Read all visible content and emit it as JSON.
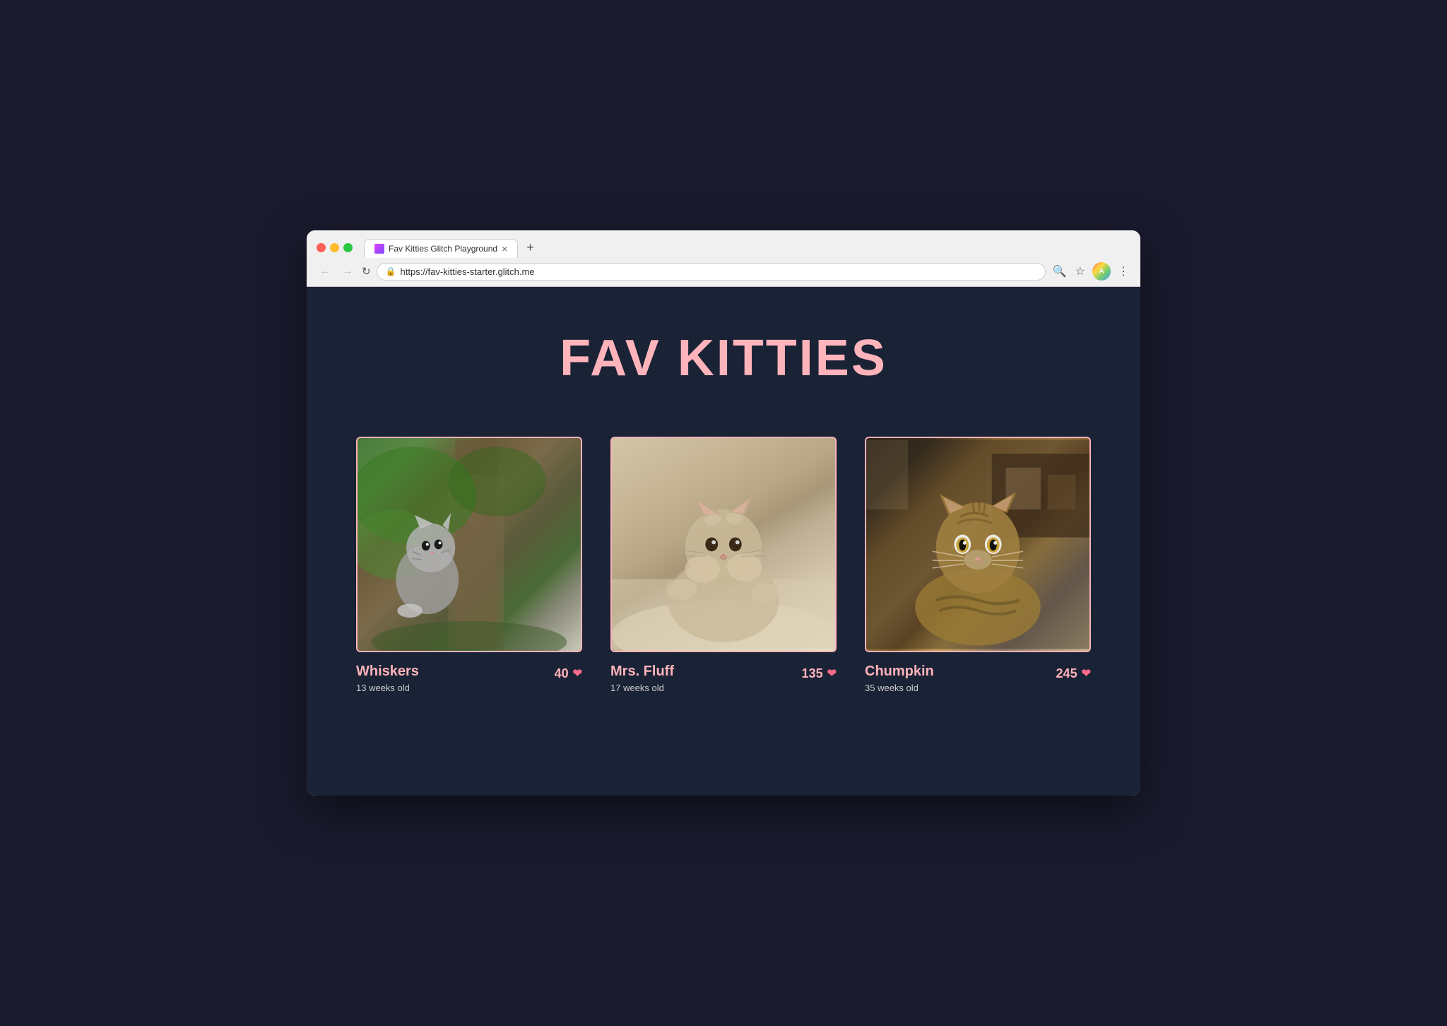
{
  "browser": {
    "tab_title": "Fav Kitties Glitch Playground",
    "tab_close": "×",
    "new_tab": "+",
    "url": "https://fav-kitties-starter.glitch.me",
    "nav": {
      "back_disabled": true,
      "forward_disabled": true
    }
  },
  "page": {
    "title": "FAV KITTIES",
    "kitties": [
      {
        "id": 1,
        "name": "Whiskers",
        "age": "13 weeks old",
        "favorites": 40,
        "image_type": "outdoor-kitten"
      },
      {
        "id": 2,
        "name": "Mrs. Fluff",
        "age": "17 weeks old",
        "favorites": 135,
        "image_type": "fluffy-kitten"
      },
      {
        "id": 3,
        "name": "Chumpkin",
        "age": "35 weeks old",
        "favorites": 245,
        "image_type": "tabby-cat"
      }
    ]
  },
  "icons": {
    "lock": "🔒",
    "search": "🔍",
    "star": "☆",
    "more": "⋮",
    "back": "←",
    "forward": "→",
    "refresh": "↻",
    "heart": "❤"
  }
}
